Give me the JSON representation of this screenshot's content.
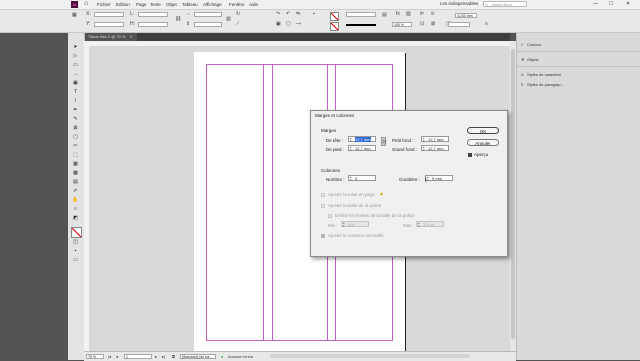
{
  "menubar": {
    "logo": "Id",
    "items": [
      "Fichier",
      "Edition",
      "Page",
      "Texte",
      "Objet",
      "Tableau",
      "Affichage",
      "Fenêtre",
      "Aide"
    ],
    "workspace": "Les indispensables",
    "search_placeholder": "Adobe Stock",
    "window_controls": [
      "—",
      "☐",
      "✕"
    ]
  },
  "controlbar": {
    "stroke_weight": "",
    "zoom": "100 %",
    "measure": "4,233 mm",
    "fields": [
      "",
      "",
      "",
      "",
      "",
      ""
    ]
  },
  "document_tab": {
    "label": "*Sans titre-2 @ 75 %",
    "close": "✕"
  },
  "right_panel": {
    "items": [
      {
        "label": "Contour",
        "icon": "stroke-icon"
      },
      {
        "label": "Objets",
        "icon": "objects-icon"
      },
      {
        "label": "Styles de caractère",
        "icon": "character-styles-icon"
      },
      {
        "label": "Styles de paragrap...",
        "icon": "paragraph-styles-icon"
      }
    ]
  },
  "status": {
    "zoom": "75 %",
    "page": "1",
    "style": "[Standard] (de tra...",
    "errors": "Aucune erreur"
  },
  "dialog": {
    "title": "Marges et colonnes",
    "margins_label": "Marges",
    "top_label": "De tête :",
    "top_value": "12,7 mm",
    "bottom_label": "De pied :",
    "bottom_value": "12,7 mm",
    "inside_label": "Petit fond :",
    "inside_value": "12,7 mm",
    "outside_label": "Grand fond :",
    "outside_value": "12,7 mm",
    "columns_label": "Colonnes",
    "number_label": "Nombre :",
    "number_value": "3",
    "gutter_label": "Gouttière :",
    "gutter_value": "9 mm",
    "ok_label": "OK",
    "cancel_label": "Annuler",
    "preview_label": "Aperçu",
    "preview_checked": true,
    "adjust_layout_label": "Ajuster la mise en page",
    "adjust_font_label": "Ajuster la taille de la police",
    "font_limits_label": "Définir les limites de la taille de la police",
    "min_label": "Min :",
    "min_value": "6 pt",
    "max_label": "Max :",
    "max_value": "324 pt",
    "locked_content_label": "Ajuster le contenu verrouillé"
  },
  "colors": {
    "margin_guide": "#c060c0",
    "selection": "#2f6bd8",
    "warning": "#e0a000"
  }
}
